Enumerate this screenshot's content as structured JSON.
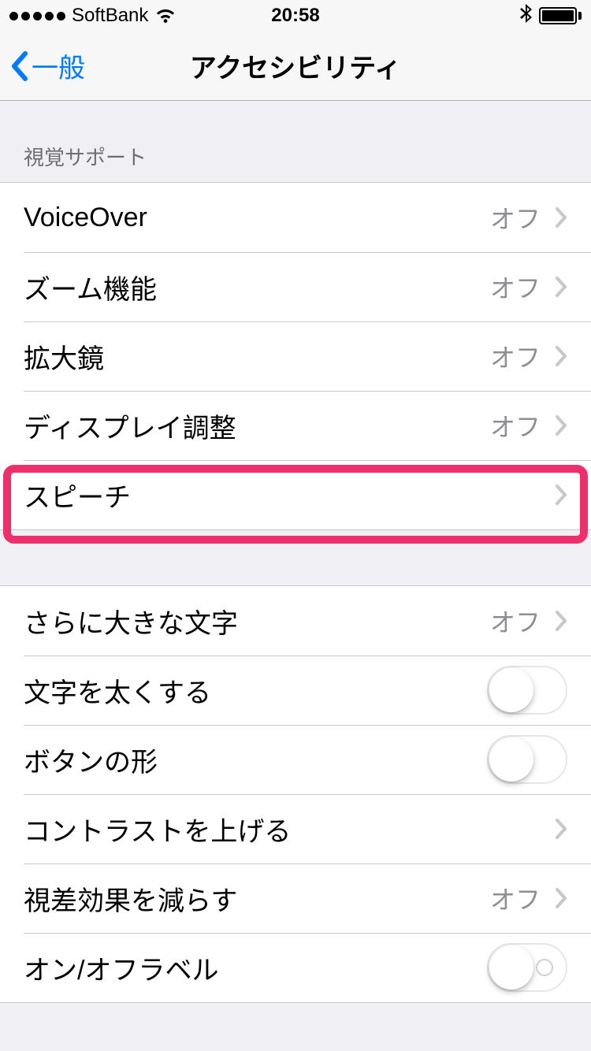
{
  "status_bar": {
    "carrier": "SoftBank",
    "time": "20:58"
  },
  "nav": {
    "back_label": "一般",
    "title": "アクセシビリティ"
  },
  "section1": {
    "header": "視覚サポート",
    "items": [
      {
        "label": "VoiceOver",
        "value": "オフ"
      },
      {
        "label": "ズーム機能",
        "value": "オフ"
      },
      {
        "label": "拡大鏡",
        "value": "オフ"
      },
      {
        "label": "ディスプレイ調整",
        "value": "オフ"
      },
      {
        "label": "スピーチ",
        "value": ""
      }
    ]
  },
  "section2": {
    "items": [
      {
        "label": "さらに大きな文字",
        "value": "オフ",
        "type": "disclosure"
      },
      {
        "label": "文字を太くする",
        "type": "toggle",
        "on": false
      },
      {
        "label": "ボタンの形",
        "type": "toggle",
        "on": false
      },
      {
        "label": "コントラストを上げる",
        "type": "disclosure",
        "value": ""
      },
      {
        "label": "視差効果を減らす",
        "value": "オフ",
        "type": "disclosure"
      },
      {
        "label": "オン/オフラベル",
        "type": "toggle",
        "on": false,
        "dot": true
      }
    ]
  }
}
